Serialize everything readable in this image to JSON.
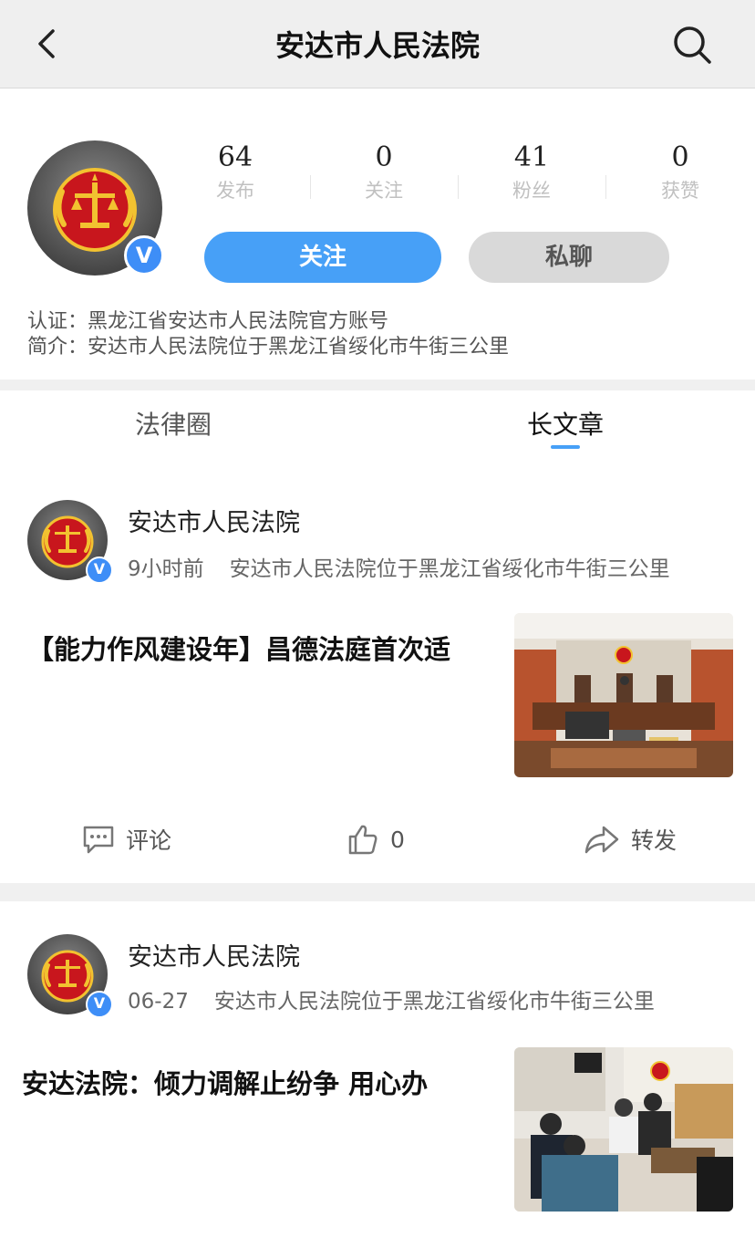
{
  "nav": {
    "title": "安达市人民法院",
    "back_icon": "back-arrow-icon",
    "search_icon": "search-icon"
  },
  "profile": {
    "verified_mark": "V",
    "stats": [
      {
        "value": "64",
        "label": "发布"
      },
      {
        "value": "0",
        "label": "关注"
      },
      {
        "value": "41",
        "label": "粉丝"
      },
      {
        "value": "0",
        "label": "获赞"
      }
    ],
    "follow_label": "关注",
    "chat_label": "私聊",
    "certification": "认证：黑龙江省安达市人民法院官方账号",
    "intro": "简介：安达市人民法院位于黑龙江省绥化市牛街三公里"
  },
  "tabs": [
    {
      "label": "法律圈",
      "active": false
    },
    {
      "label": "长文章",
      "active": true
    }
  ],
  "posts": [
    {
      "author": "安达市人民法院",
      "time": "9小时前",
      "location": "安达市人民法院位于黑龙江省绥化市牛街三公里",
      "title": "【能力作风建设年】昌德法庭首次适",
      "comment_label": "评论",
      "like_count": "0",
      "share_label": "转发"
    },
    {
      "author": "安达市人民法院",
      "time": "06-27",
      "location": "安达市人民法院位于黑龙江省绥化市牛街三公里",
      "title": "安达法院：倾力调解止纷争 用心办"
    }
  ],
  "colors": {
    "accent": "#47a0f7",
    "verified": "#3e8ef7",
    "emblem_red": "#c8161d",
    "emblem_gold": "#f2c230"
  }
}
